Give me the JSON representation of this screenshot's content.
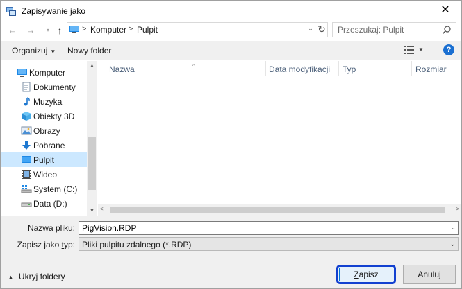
{
  "window": {
    "title": "Zapisywanie jako",
    "close_glyph": "✕"
  },
  "nav": {
    "back_glyph": "←",
    "forward_glyph": "→",
    "recent_glyph": "▾",
    "up_glyph": "↑",
    "address": {
      "segments": [
        "Komputer",
        "Pulpit"
      ],
      "separator": ">",
      "dropdown_glyph": "⌄",
      "refresh_glyph": "↻"
    },
    "search": {
      "placeholder": "Przeszukaj: Pulpit"
    }
  },
  "toolbar": {
    "organize_label": "Organizuj",
    "organize_caret": "▼",
    "new_folder_label": "Nowy folder",
    "view_caret": "▼",
    "help_glyph": "?"
  },
  "tree": {
    "root": {
      "label": "Komputer",
      "icon": "computer-icon"
    },
    "items": [
      {
        "label": "Dokumenty",
        "icon": "documents-icon"
      },
      {
        "label": "Muzyka",
        "icon": "music-icon"
      },
      {
        "label": "Obiekty 3D",
        "icon": "objects-3d-icon"
      },
      {
        "label": "Obrazy",
        "icon": "pictures-icon"
      },
      {
        "label": "Pobrane",
        "icon": "downloads-icon"
      },
      {
        "label": "Pulpit",
        "icon": "desktop-icon",
        "selected": true
      },
      {
        "label": "Wideo",
        "icon": "video-icon"
      },
      {
        "label": "System (C:)",
        "icon": "system-drive-icon"
      },
      {
        "label": "Data (D:)",
        "icon": "data-drive-icon"
      }
    ]
  },
  "columns": {
    "name": "Nazwa",
    "modified": "Data modyfikacji",
    "type": "Typ",
    "size": "Rozmiar",
    "sort_glyph": "^"
  },
  "scroll": {
    "up_glyph": "▲",
    "down_glyph": "▼",
    "left_glyph": "<",
    "right_glyph": ">"
  },
  "form": {
    "filename_label": "Nazwa pliku:",
    "filename_value": "PigVision.RDP",
    "filetype_label_prefix": "Zapisz jako ",
    "filetype_label_underlined": "t",
    "filetype_label_suffix": "yp:",
    "filetype_value": "Pliki pulpitu zdalnego (*.RDP)",
    "caret_glyph": "⌄",
    "hide_folders_caret": "▲",
    "hide_folders_label": "Ukryj foldery",
    "save_label_underlined": "Z",
    "save_label_rest": "apisz",
    "cancel_label": "Anuluj"
  },
  "colors": {
    "accent": "#0078d7",
    "save_highlight": "#1240d0",
    "selected_row": "#cce8ff",
    "help_icon": "#1a6fd1"
  }
}
